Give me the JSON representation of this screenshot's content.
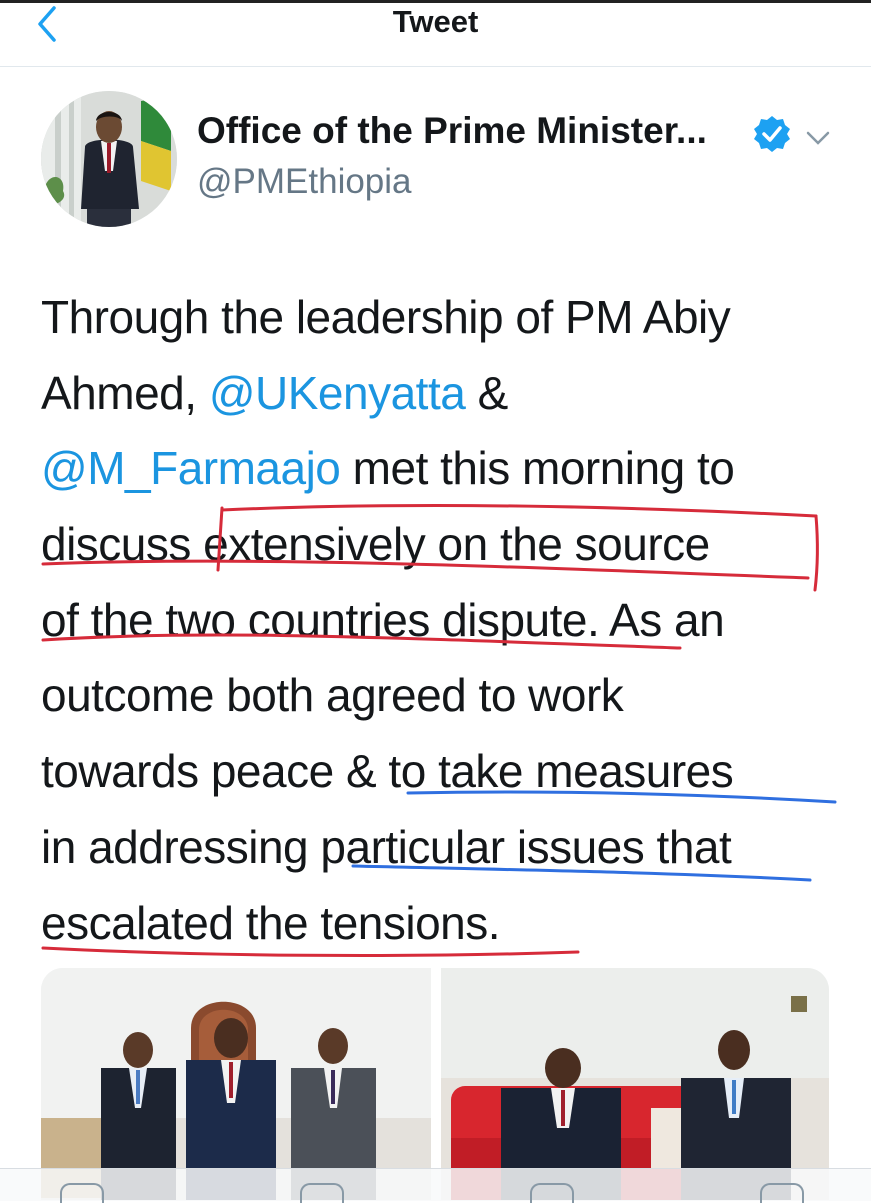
{
  "header": {
    "title": "Tweet",
    "back_icon": "chevron-left-icon"
  },
  "author": {
    "name": "Office of the Prime Minister...",
    "handle": "@PMEthiopia",
    "verified_icon": "verified-badge-icon",
    "menu_icon": "chevron-down-icon"
  },
  "tweet": {
    "lines": [
      [
        {
          "text": "Through the leadership of PM Abiy"
        }
      ],
      [
        {
          "text": "Ahmed, "
        },
        {
          "text": "@UKenyatta",
          "mention": true
        },
        {
          "text": " &"
        }
      ],
      [
        {
          "text": "@M_Farmaajo",
          "mention": true
        },
        {
          "text": " met this morning to"
        }
      ],
      [
        {
          "text": "discuss extensively on the source"
        }
      ],
      [
        {
          "text": "of the two countries dispute. As an"
        }
      ],
      [
        {
          "text": "outcome both agreed to work"
        }
      ],
      [
        {
          "text": "towards peace & to take measures"
        }
      ],
      [
        {
          "text": "in addressing particular issues that"
        }
      ],
      [
        {
          "text": "escalated the tensions."
        }
      ]
    ]
  },
  "media": {
    "photos": [
      "photo-three-leaders-standing",
      "photo-two-leaders-seated"
    ]
  },
  "colors": {
    "accent": "#1da1f2",
    "mention": "#1b95e0",
    "red_annotation": "#d62b3a",
    "blue_annotation": "#2f6fe0"
  }
}
